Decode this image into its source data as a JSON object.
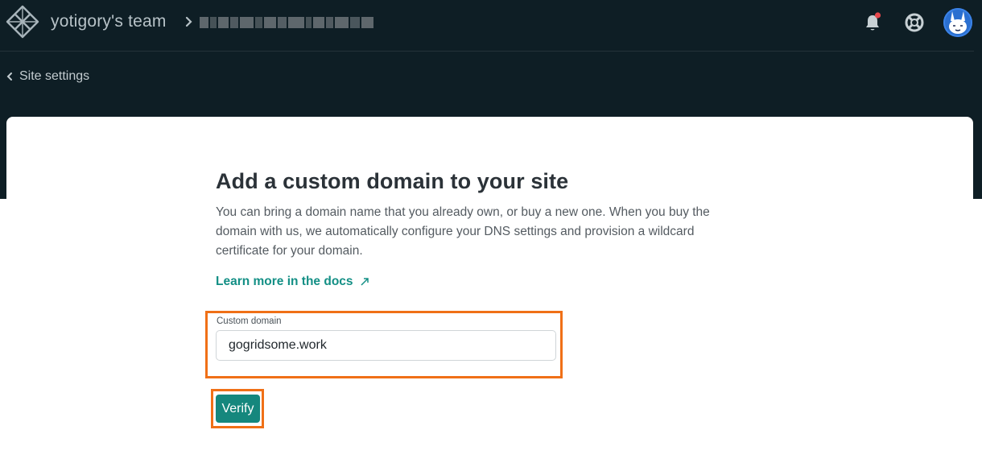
{
  "header": {
    "team_name": "yotigory's team",
    "site_name_redacted": true
  },
  "nav": {
    "back_label": "Site settings"
  },
  "main": {
    "title": "Add a custom domain to your site",
    "description": "You can bring a domain name that you already own, or buy a new one. When you buy the domain with us, we automatically configure your DNS settings and provision a wildcard certificate for your domain.",
    "docs_link": "Learn more in the docs",
    "field_label": "Custom domain",
    "field_value": "gogridsome.work",
    "verify_label": "Verify"
  },
  "icons": {
    "logo": "netlify-logo-icon",
    "breadcrumb_separator": "chevron-right-icon",
    "notifications": "bell-icon",
    "help": "lifebuoy-icon",
    "back": "chevron-left-icon",
    "external_link": "arrow-up-right-icon"
  },
  "colors": {
    "header_bg": "#0e1e25",
    "accent": "#15877d",
    "link": "#138f85",
    "highlight": "#f07017",
    "notification_dot": "#e5484d"
  }
}
